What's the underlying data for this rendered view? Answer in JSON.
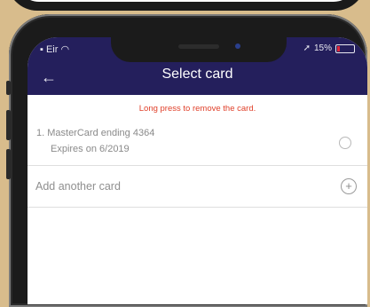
{
  "status_bar": {
    "carrier": "Eir",
    "battery_percent": "15%",
    "battery_level": 0.15
  },
  "nav": {
    "title": "Select card",
    "back_icon": "back-arrow-icon",
    "background": "#241f5c"
  },
  "hint": "Long press to remove the card.",
  "cards": [
    {
      "line1": "1.  MasterCard ending 4364",
      "line2": "Expires on 6/2019"
    }
  ],
  "add_card": {
    "label": "Add another card",
    "icon": "plus-circle-icon"
  },
  "colors": {
    "accent": "#e0402a",
    "battery_low": "#e0253a"
  }
}
